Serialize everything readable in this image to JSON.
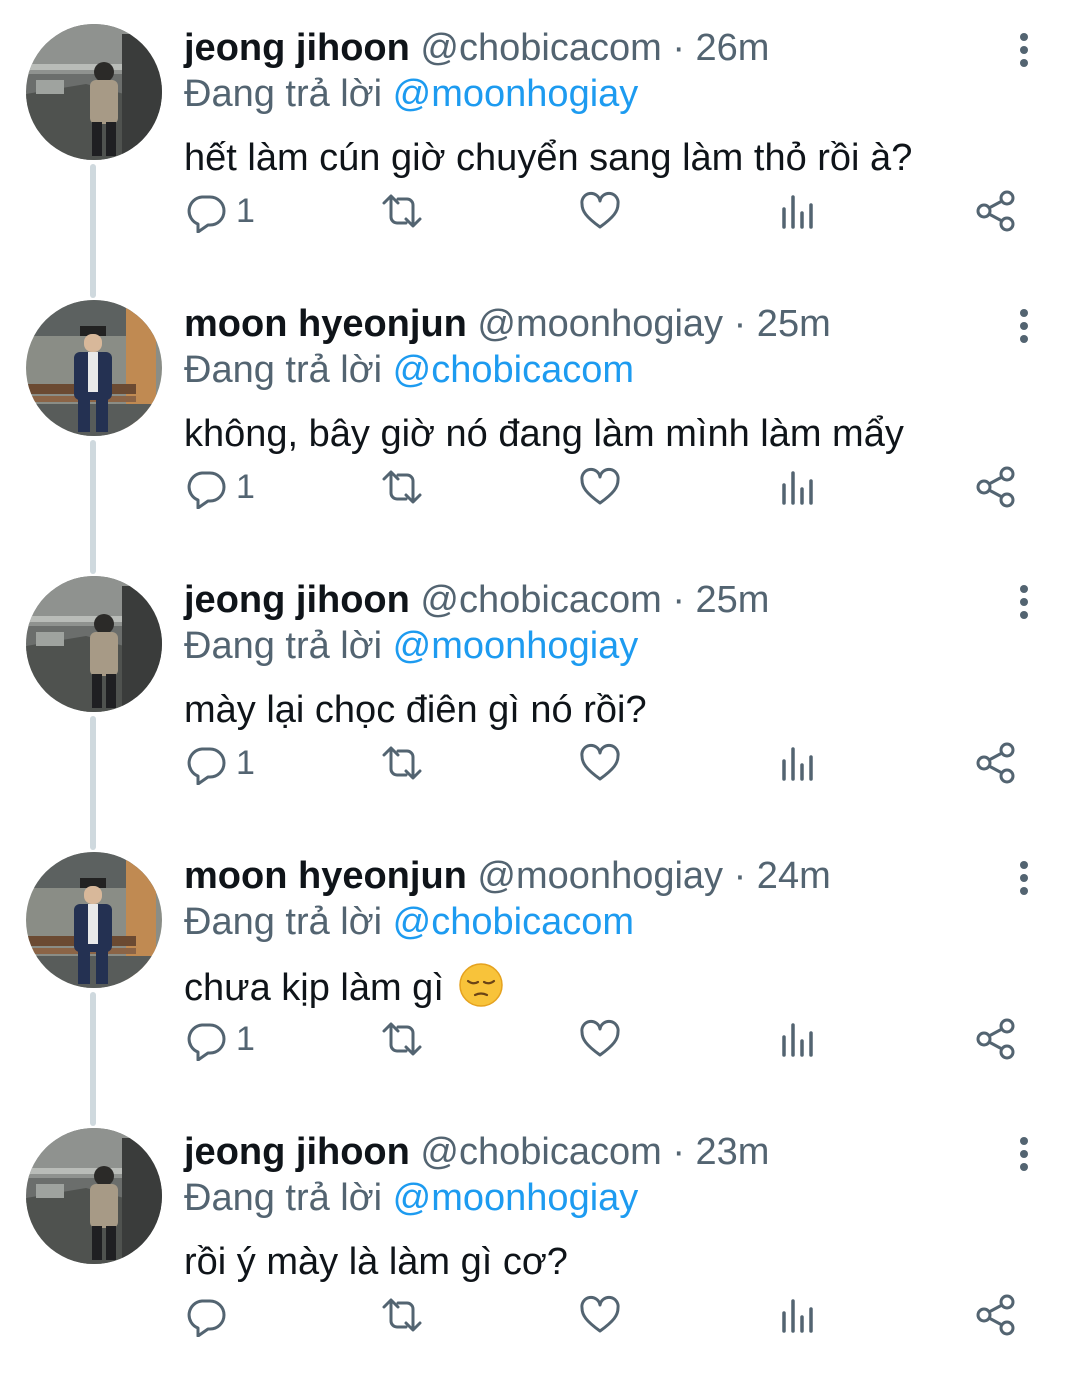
{
  "reply_prefix": "Đang trả lời",
  "tweets": [
    {
      "name": "jeong jihoon",
      "meta": " @chobicacom · 26m",
      "reply_to": "@moonhogiay",
      "text": "hết làm cún giờ chuyển sang làm thỏ rồi à?",
      "reply_count": "1",
      "avatar": "garage-photo-avatar"
    },
    {
      "name": "moon hyeonjun",
      "meta": " @moonhogiay · 25m",
      "reply_to": "@chobicacom",
      "text": "không, bây giờ nó đang làm mình làm mẩy",
      "reply_count": "1",
      "avatar": "suit-bench-photo-avatar"
    },
    {
      "name": "jeong jihoon",
      "meta": " @chobicacom · 25m",
      "reply_to": "@moonhogiay",
      "text": "mày lại chọc điên gì nó rồi?",
      "reply_count": "1",
      "avatar": "garage-photo-avatar"
    },
    {
      "name": "moon hyeonjun",
      "meta": " @moonhogiay · 24m",
      "reply_to": "@chobicacom",
      "text": "chưa kịp làm gì",
      "emoji": "pensive-face-emoji",
      "reply_count": "1",
      "avatar": "suit-bench-photo-avatar"
    },
    {
      "name": "jeong jihoon",
      "meta": " @chobicacom · 23m",
      "reply_to": "@moonhogiay",
      "text": "rồi ý mày là làm gì cơ?",
      "reply_count": "",
      "avatar": "garage-photo-avatar"
    }
  ],
  "colors": {
    "text": "#0f1419",
    "secondary": "#536471",
    "mention": "#1d9bf0",
    "thread_line": "#cfd9de"
  }
}
